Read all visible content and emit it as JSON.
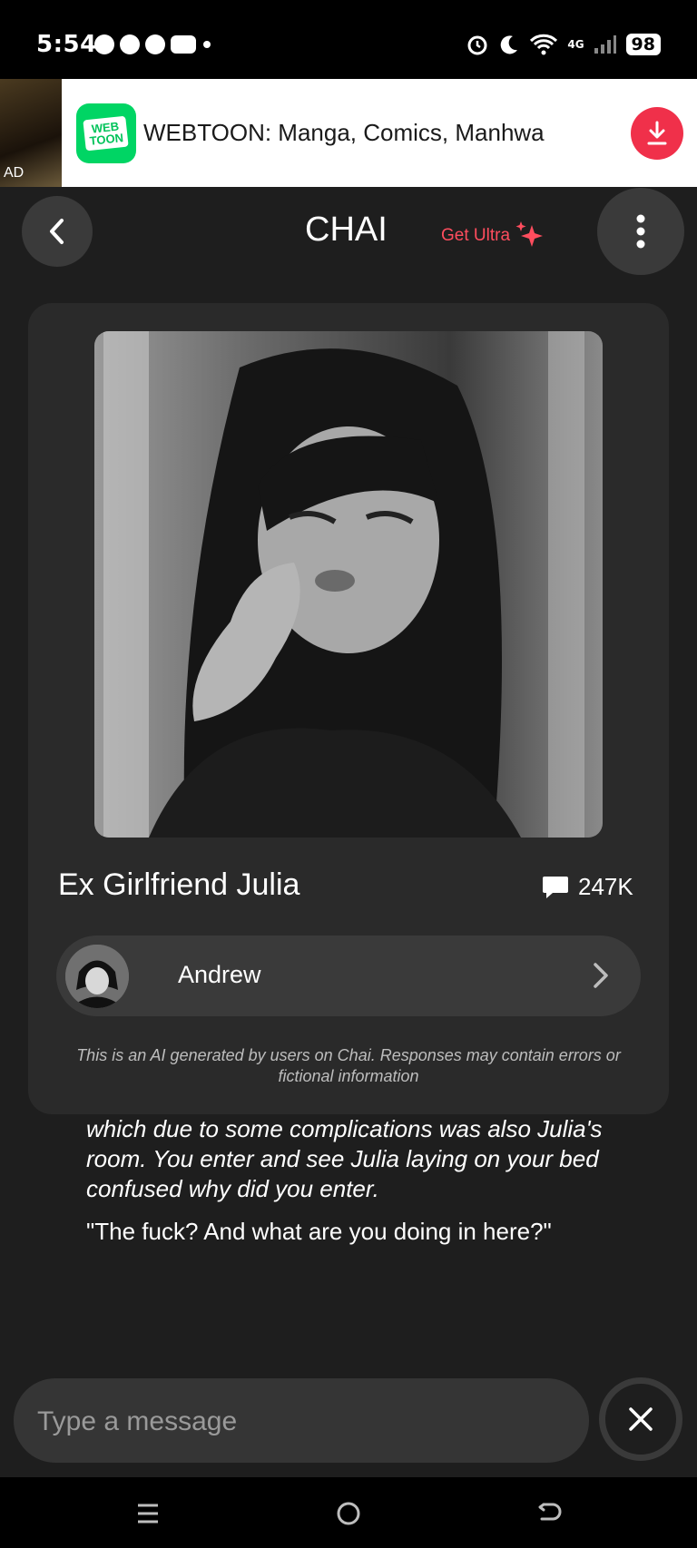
{
  "status_bar": {
    "time": "5:54",
    "network": "4G",
    "battery": "98"
  },
  "ad": {
    "tag": "AD",
    "app_name": "WEBTOON: Manga, Comics, Manhwa",
    "logo_text": "WEB TOON"
  },
  "header": {
    "title": "CHAI",
    "upgrade_label": "Get Ultra"
  },
  "character": {
    "name": "Ex Girlfriend Julia",
    "message_count": "247K",
    "creator_name": "Andrew",
    "disclaimer": "This is an AI generated by users on Chai. Responses may contain errors or fictional information"
  },
  "chat": {
    "narration": "which due to some complications was also Julia's room. You enter and see Julia laying on your bed confused why did you enter.",
    "dialogue": "\"The fuck? And what are you doing in here?\""
  },
  "composer": {
    "placeholder": "Type a message"
  },
  "colors": {
    "accent": "#ff4d5e",
    "background": "#1e1e1e",
    "card": "#2a2a2a",
    "webtoon_green": "#00d564",
    "download_red": "#f0304a"
  }
}
